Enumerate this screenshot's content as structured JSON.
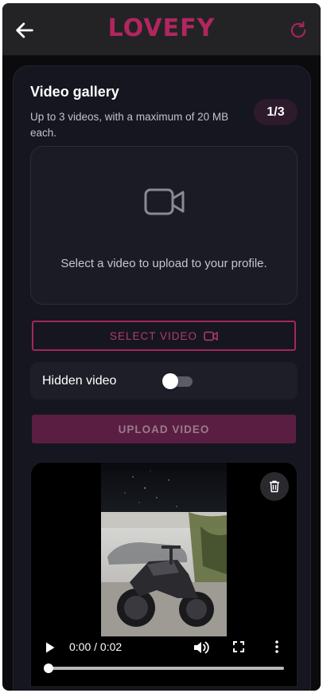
{
  "app": {
    "logo": "LOVEFY",
    "back_icon": "arrow-left-icon",
    "refresh_icon": "refresh-icon",
    "brand_color": "#b2265f"
  },
  "gallery": {
    "title": "Video gallery",
    "subtitle": "Up to 3 videos, with a maximum of 20 MB each.",
    "count_badge": "1/3",
    "upload_placeholder": "Select a video to upload to your profile.",
    "placeholder_icon": "video-camera-icon",
    "select_button": "SELECT VIDEO",
    "select_button_icon": "video-camera-icon",
    "hidden_video_label": "Hidden video",
    "hidden_video_enabled": false,
    "upload_button": "UPLOAD VIDEO"
  },
  "video_player": {
    "delete_icon": "trash-icon",
    "time": "0:00 / 0:02",
    "progress": 0,
    "controls": [
      "play-icon",
      "volume-icon",
      "fullscreen-icon",
      "more-vertical-icon"
    ]
  }
}
